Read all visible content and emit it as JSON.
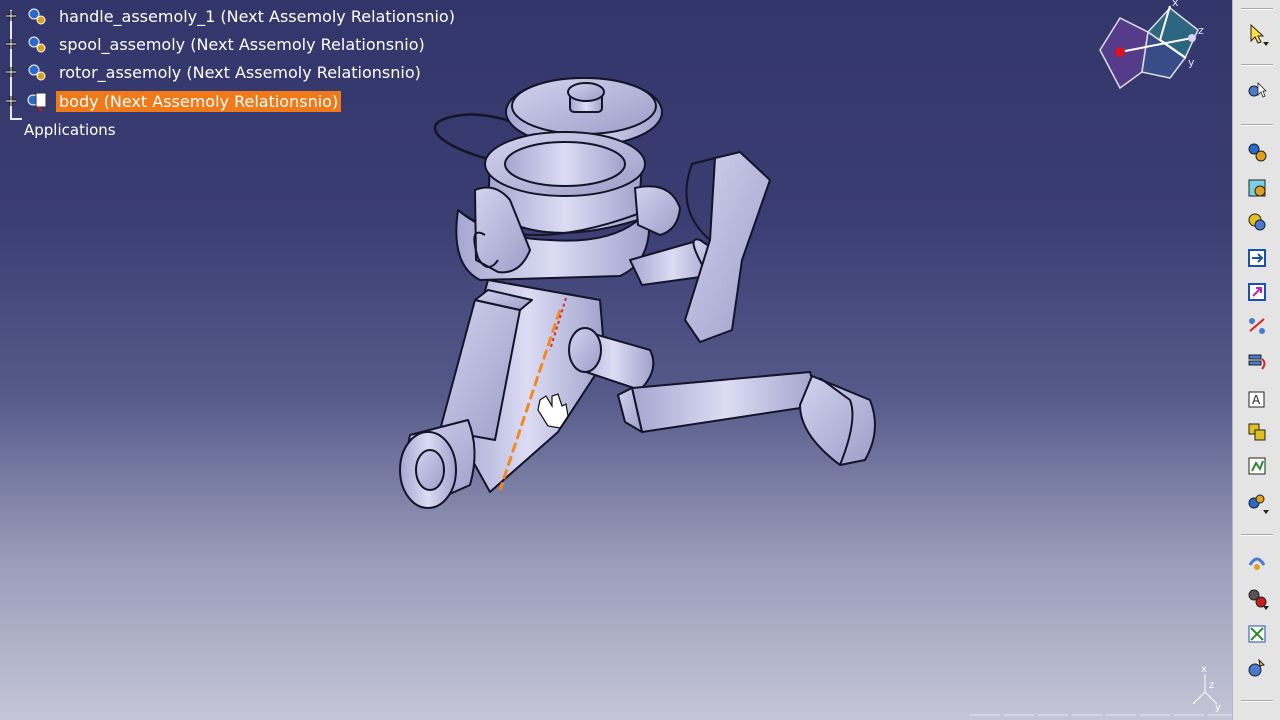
{
  "tree": {
    "items": [
      {
        "label": "handle_assemoly_1 (Next Assemoly Relationsnio)",
        "selected": false
      },
      {
        "label": "spool_assemoly (Next Assemoly Relationsnio)",
        "selected": false
      },
      {
        "label": "rotor_assemoly (Next Assemoly Relationsnio)",
        "selected": false
      },
      {
        "label": "body (Next Assemoly Relationsnio)",
        "selected": true
      }
    ],
    "applications_label": "Applications"
  },
  "compass": {
    "axis_labels": [
      "x",
      "y",
      "z"
    ]
  },
  "axis_indicator": {
    "labels": [
      "x",
      "y",
      "z"
    ]
  },
  "toolbar": {
    "buttons": [
      {
        "name": "select-arrow-icon"
      },
      {
        "name": "fly-mode-icon"
      },
      {
        "name": "product-components-icon"
      },
      {
        "name": "existing-component-icon"
      },
      {
        "name": "existing-component-positioning-icon"
      },
      {
        "name": "replace-component-icon"
      },
      {
        "name": "graph-tree-reordering-icon"
      },
      {
        "name": "generate-numbering-icon"
      },
      {
        "name": "selective-load-icon"
      },
      {
        "name": "manage-representations-icon"
      },
      {
        "name": "multi-instantiation-icon"
      },
      {
        "name": "fast-multi-instantiation-icon"
      },
      {
        "name": "manipulation-icon"
      },
      {
        "name": "snap-icon"
      },
      {
        "name": "explode-icon"
      },
      {
        "name": "stop-manipulate-on-clash-icon"
      }
    ]
  },
  "colors": {
    "selection": "#f07a1a",
    "background_top": "#33366a",
    "background_bottom": "#c4c5d6"
  }
}
